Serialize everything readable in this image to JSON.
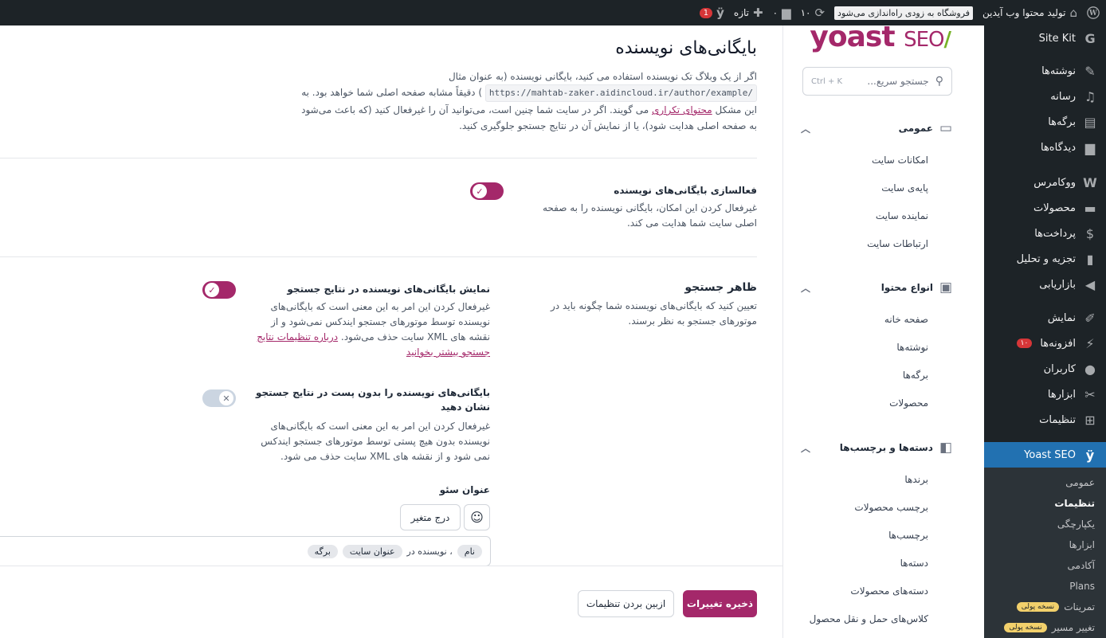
{
  "adminbar": {
    "site_name": "تولید محتوا وب آیدین",
    "notice": "فروشگاه به زودی راه‌اندازی می‌شود",
    "updates_count": "۱۰",
    "comments_count": "۰",
    "new_label": "تازه",
    "yoast_badge": "1"
  },
  "wpmenu": {
    "items": [
      {
        "label": "Site Kit",
        "icon": "google-icon"
      },
      {
        "label": "نوشته‌ها",
        "icon": "pin-icon"
      },
      {
        "label": "رسانه",
        "icon": "media-icon"
      },
      {
        "label": "برگه‌ها",
        "icon": "pages-icon"
      },
      {
        "label": "دیدگاه‌ها",
        "icon": "comments-icon"
      },
      {
        "label": "ووکامرس",
        "icon": "woo-icon"
      },
      {
        "label": "محصولات",
        "icon": "products-icon"
      },
      {
        "label": "پرداخت‌ها",
        "icon": "payments-icon"
      },
      {
        "label": "تجزیه و تحلیل",
        "icon": "analytics-icon"
      },
      {
        "label": "بازاریابی",
        "icon": "megaphone-icon"
      },
      {
        "label": "نمایش",
        "icon": "brush-icon"
      },
      {
        "label": "افزونه‌ها",
        "icon": "plugin-icon",
        "badge": "۱۰"
      },
      {
        "label": "کاربران",
        "icon": "users-icon"
      },
      {
        "label": "ابزارها",
        "icon": "tools-icon"
      },
      {
        "label": "تنظیمات",
        "icon": "settings-icon"
      },
      {
        "label": "Yoast SEO",
        "icon": "yoast-icon"
      }
    ],
    "sub": [
      {
        "label": "عمومی"
      },
      {
        "label": "تنظیمات"
      },
      {
        "label": "یکپارچگی"
      },
      {
        "label": "ابزارها"
      },
      {
        "label": "آکادمی"
      },
      {
        "label": "Plans"
      },
      {
        "label": "تمرینات",
        "pill": "نسخه پولی"
      },
      {
        "label": "تغییر مسیر",
        "pill": "نسخه پولی"
      }
    ]
  },
  "ynav": {
    "logo_main": "yoast",
    "logo_seo": "SEO",
    "logo_slash": "/",
    "search_placeholder": "جستجو سریع...",
    "search_kbd": "Ctrl + K",
    "sections": [
      {
        "title": "عمومی",
        "items": [
          "امکانات سایت",
          "پایه‌ی سایت",
          "نماینده سایت",
          "ارتباطات سایت"
        ]
      },
      {
        "title": "انواع محتوا",
        "items": [
          "صفحه خانه",
          "نوشته‌ها",
          "برگه‌ها",
          "محصولات"
        ]
      },
      {
        "title": "دسته‌ها و برچسب‌ها",
        "items": [
          "برندها",
          "برچسب محصولات",
          "برچسب‌ها",
          "دسته‌ها",
          "دسته‌های محصولات",
          "کلاس‌های حمل و نقل محصول"
        ]
      }
    ]
  },
  "main": {
    "title": "بایگانی‌های نویسنده",
    "intro_part1": "اگر از یک وبلاگ تک نویسنده استفاده می کنید، بایگانی نویسنده (به عنوان مثال",
    "intro_code": "https://mahtab-zaker.aidincloud.ir/author/example/",
    "intro_part2": ") دقیقاً مشابه صفحه اصلی شما خواهد بود. به این مشکل",
    "intro_link": "محتوای تکراری",
    "intro_part3": "می گویند. اگر در سایت شما چنین است، می‌توانید آن را غیرفعال کنید (که باعث می‌شود به صفحه اصلی هدایت شود)، یا از نمایش آن در نتایج جستجو جلوگیری کنید.",
    "enable": {
      "label": "فعالسازی بایگانی‌های نویسنده",
      "desc": "غیرفعال کردن این امکان، بایگانی نویسنده را به صفحه اصلی سایت شما هدایت می کند.",
      "checked": true
    },
    "search_appearance": {
      "title": "ظاهر جستجو",
      "desc": "تعیین کنید که بایگانی‌های نویسنده شما چگونه باید در موتورهای جستجو به نظر برسند."
    },
    "show_in_search": {
      "label": "نمایش بایگانی‌های نویسنده در نتایج جستجو",
      "desc": "غیرفعال کردن این امر به این معنی است که بایگانی‌های نویسنده توسط موتورهای جستجو ایندکس نمی‌شود و از نقشه های XML سایت حذف می‌شود.",
      "link": "درباره تنظیمات نتایج جستجو بیشتر بخوانید",
      "checked": true
    },
    "no_posts": {
      "label": "بایگانی‌های نویسنده را بدون پست در نتایج جستجو نشان دهید",
      "desc": "غیرفعال کردن این امر به این معنی است که بایگانی‌های نویسنده بدون هیچ پستی توسط موتورهای جستجو ایندکس نمی شود و از نقشه های XML سایت حذف می شود.",
      "checked": false
    },
    "seo_title": {
      "label": "عنوان سئو",
      "insert_variable": "درج متغیر",
      "token_name": "نام",
      "text_mid": "، نویسنده در",
      "token_site": "عنوان سایت",
      "token_page": "برگه"
    },
    "footer": {
      "save": "ذخیره تغییرات",
      "discard": "ازبین بردن تنظیمات"
    }
  }
}
